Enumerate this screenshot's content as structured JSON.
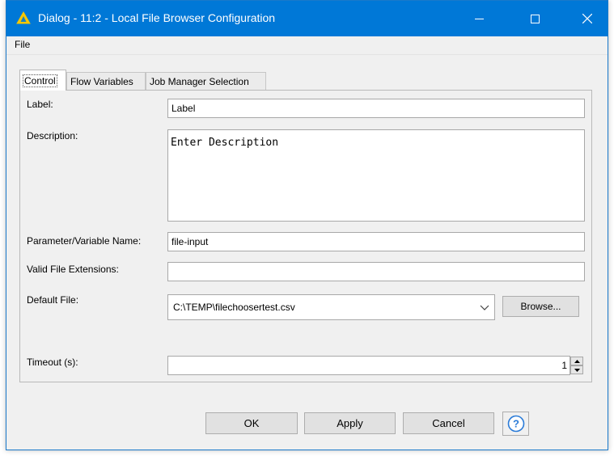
{
  "window": {
    "title": "Dialog - 11:2 - Local File Browser Configuration",
    "accent_color": "#0078d7",
    "icon": "warning-triangle-icon"
  },
  "menu": {
    "file_label": "File"
  },
  "tabs": [
    {
      "label": "Control",
      "active": true
    },
    {
      "label": "Flow Variables",
      "active": false
    },
    {
      "label": "Job Manager Selection",
      "active": false
    }
  ],
  "form": {
    "label_label": "Label:",
    "label_value": "Label",
    "description_label": "Description:",
    "description_value": "Enter Description",
    "param_label": "Parameter/Variable Name:",
    "param_value": "file-input",
    "extensions_label": "Valid File Extensions:",
    "extensions_value": "",
    "default_file_label": "Default File:",
    "default_file_value": "C:\\TEMP\\filechoosertest.csv",
    "browse_label": "Browse...",
    "timeout_label": "Timeout (s):",
    "timeout_value": "1"
  },
  "footer": {
    "ok_label": "OK",
    "apply_label": "Apply",
    "cancel_label": "Cancel",
    "help_icon": "help-question-icon"
  }
}
